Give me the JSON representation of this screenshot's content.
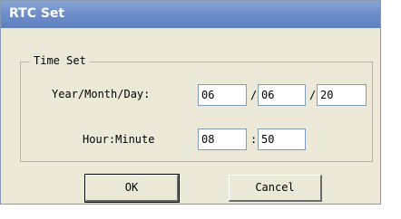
{
  "window": {
    "title": "RTC Set"
  },
  "group": {
    "label": "Time Set"
  },
  "date": {
    "label": "Year/Month/Day:",
    "year": "06",
    "month": "06",
    "day": "20",
    "sep1": "/",
    "sep2": "/"
  },
  "time": {
    "label": "Hour:Minute",
    "hour": "08",
    "minute": "50",
    "sep": ":"
  },
  "buttons": {
    "ok_label": "OK",
    "cancel_label": "Cancel"
  },
  "colors": {
    "titlebar": "#6f8fca",
    "dialog_bg": "#ece9d8",
    "field_border": "#7f9db9"
  }
}
